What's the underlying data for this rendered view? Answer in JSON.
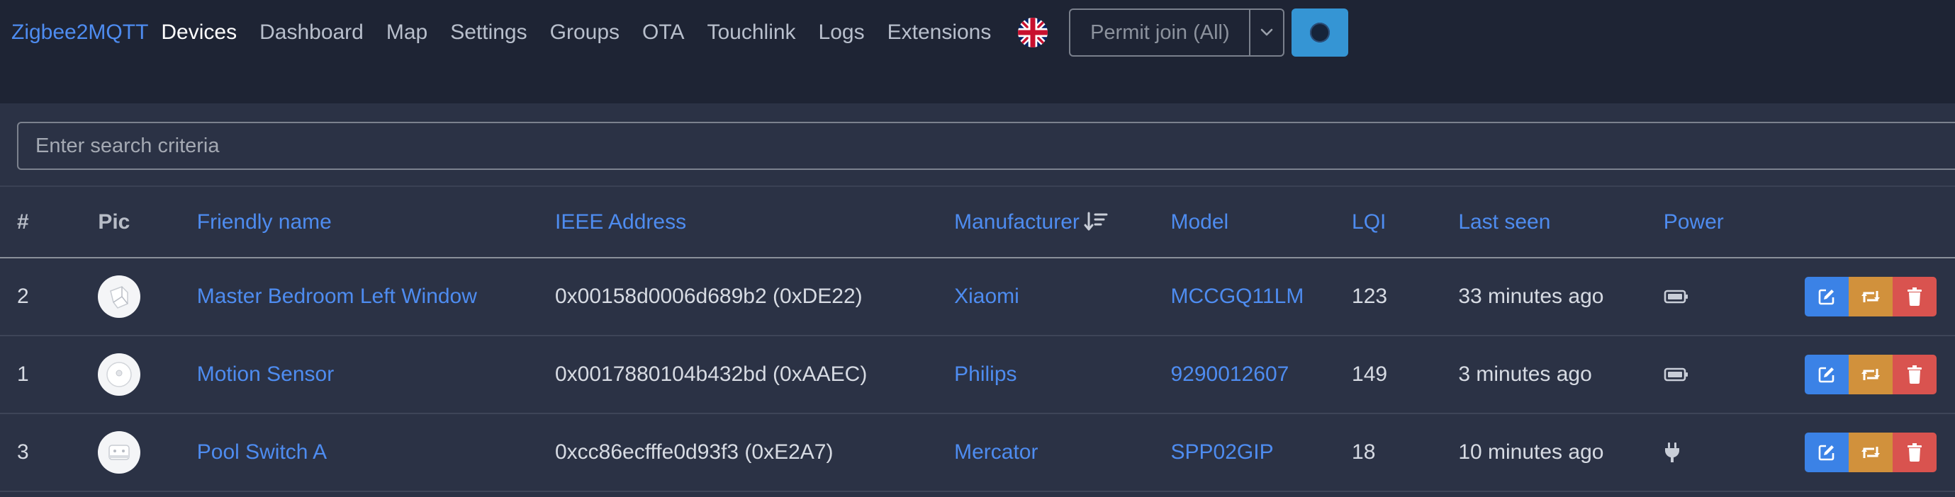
{
  "nav": {
    "brand": "Zigbee2MQTT",
    "links": [
      "Devices",
      "Dashboard",
      "Map",
      "Settings",
      "Groups",
      "OTA",
      "Touchlink",
      "Logs",
      "Extensions"
    ],
    "language_icon": "uk-flag-icon",
    "permit_join_label": "Permit join (All)",
    "theme_icon": "theme-toggle-icon"
  },
  "search": {
    "placeholder": "Enter search criteria",
    "value": ""
  },
  "table": {
    "headers": {
      "index": "#",
      "pic": "Pic",
      "friendly_name": "Friendly name",
      "ieee": "IEEE Address",
      "manufacturer": "Manufacturer",
      "model": "Model",
      "lqi": "LQI",
      "last_seen": "Last seen",
      "power": "Power"
    },
    "sort_column": "manufacturer",
    "rows": [
      {
        "index": "2",
        "friendly_name": "Master Bedroom Left Window",
        "ieee": "0x00158d0006d689b2 (0xDE22)",
        "manufacturer": "Xiaomi",
        "model": "MCCGQ11LM",
        "lqi": "123",
        "last_seen": "33 minutes ago",
        "power_icon": "battery-icon"
      },
      {
        "index": "1",
        "friendly_name": "Motion Sensor",
        "ieee": "0x0017880104b432bd (0xAAEC)",
        "manufacturer": "Philips",
        "model": "9290012607",
        "lqi": "149",
        "last_seen": "3 minutes ago",
        "power_icon": "battery-icon"
      },
      {
        "index": "3",
        "friendly_name": "Pool Switch A",
        "ieee": "0xcc86ecfffe0d93f3 (0xE2A7)",
        "manufacturer": "Mercator",
        "model": "SPP02GIP",
        "lqi": "18",
        "last_seen": "10 minutes ago",
        "power_icon": "plug-icon"
      }
    ]
  },
  "colors": {
    "accent": "#4e8cf0",
    "navbar_bg": "#1e2434",
    "page_bg": "#2b3245",
    "edit_button": "#3b82e6",
    "rename_button": "#d1913c",
    "remove_button": "#d9534f",
    "theme_button": "#3595d4"
  }
}
